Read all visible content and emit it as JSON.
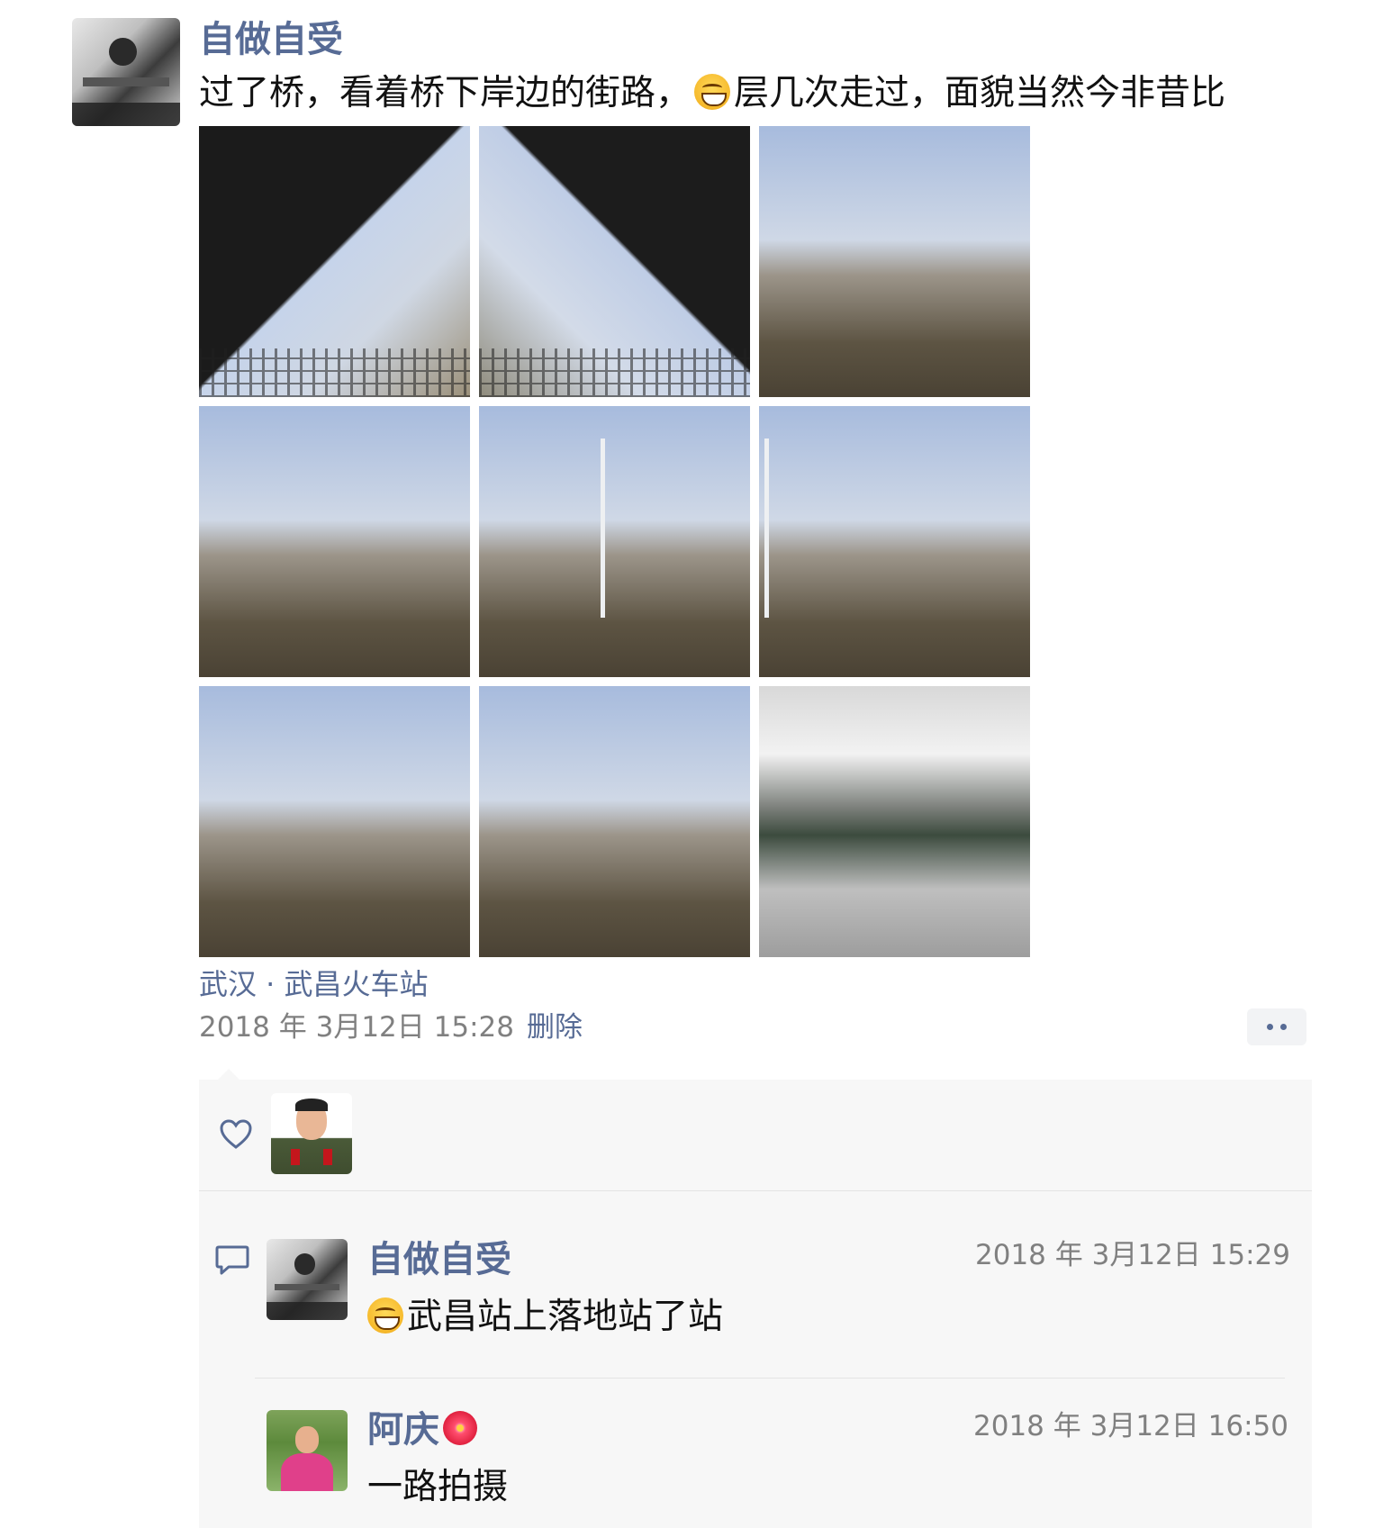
{
  "post": {
    "author": "自做自受",
    "text_before_emoji": "过了桥，看着桥下岸边的街路，",
    "text_after_emoji": "层几次走过，面貌当然今非昔比",
    "emoji_icon": "grinning-face-emoji",
    "photos": [
      {
        "name": "photo-bridge-view-1",
        "style": "bridge"
      },
      {
        "name": "photo-bridge-view-2",
        "style": "bridge2"
      },
      {
        "name": "photo-riverside-street-1",
        "style": "trees"
      },
      {
        "name": "photo-riverside-street-2",
        "style": "trees"
      },
      {
        "name": "photo-tower-trees-1",
        "style": "trees",
        "tower": true
      },
      {
        "name": "photo-tower-trees-2",
        "style": "trees",
        "tower": true
      },
      {
        "name": "photo-city-trees-1",
        "style": "trees"
      },
      {
        "name": "photo-city-trees-2",
        "style": "trees"
      },
      {
        "name": "photo-train-station-platform",
        "style": "station"
      }
    ],
    "location": "武汉 · 武昌火车站",
    "timestamp": "2018 年 3月12日 15:28",
    "delete_label": "删除"
  },
  "likes": {
    "icon": "heart-icon"
  },
  "comments": [
    {
      "author": "自做自受",
      "time": "2018 年 3月12日 15:29",
      "text": "武昌站上落地站了站",
      "leading_emoji": "grinning-face-emoji"
    },
    {
      "author": "阿庆",
      "author_emoji": "hibiscus-emoji",
      "time": "2018 年 3月12日 16:50",
      "text": "一路拍摄"
    }
  ],
  "colors": {
    "link_blue": "#576b95",
    "text": "#111111",
    "meta_gray": "#808080",
    "panel_bg": "#f7f7f7"
  }
}
